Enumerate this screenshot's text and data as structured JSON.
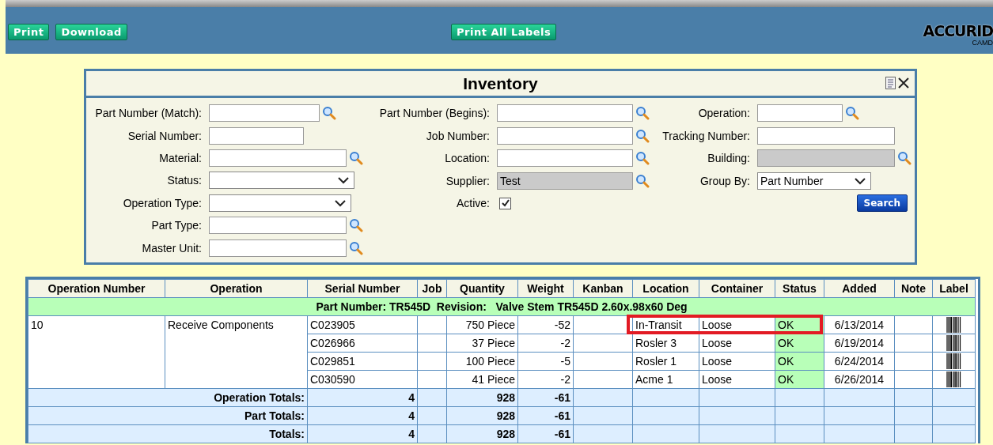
{
  "header": {
    "buttons": [
      "Print",
      "Download"
    ],
    "center_button": "Print All Labels",
    "logo": {
      "name": "ACCURID",
      "sub": "CAMD"
    }
  },
  "panel": {
    "title": "Inventory",
    "columns": [
      [
        {
          "label": "Part Number (Match):",
          "kind": "text",
          "lookup": true,
          "disabled": false
        },
        {
          "label": "Serial Number:",
          "kind": "text",
          "lookup": false,
          "disabled": false
        },
        {
          "label": "Material:",
          "kind": "text",
          "lookup": true,
          "disabled": false
        },
        {
          "label": "Status:",
          "kind": "select",
          "lookup": false,
          "disabled": false
        },
        {
          "label": "Operation Type:",
          "kind": "select",
          "lookup": false,
          "disabled": false
        },
        {
          "label": "Part Type:",
          "kind": "text",
          "lookup": true,
          "disabled": false
        },
        {
          "label": "Master Unit:",
          "kind": "text",
          "lookup": true,
          "disabled": false
        }
      ],
      [
        {
          "label": "Part Number (Begins):",
          "kind": "text",
          "lookup": true,
          "disabled": false
        },
        {
          "label": "Job Number:",
          "kind": "text",
          "lookup": true,
          "disabled": false
        },
        {
          "label": "Location:",
          "kind": "text",
          "lookup": true,
          "disabled": false
        },
        {
          "label": "Supplier:",
          "kind": "text",
          "value": "Test",
          "lookup": true,
          "disabled": true
        },
        {
          "label": "Active:",
          "kind": "checkbox",
          "checked": true
        }
      ],
      [
        {
          "label": "Operation:",
          "kind": "text",
          "lookup": true,
          "disabled": false
        },
        {
          "label": "Tracking Number:",
          "kind": "text",
          "lookup": false,
          "disabled": false
        },
        {
          "label": "Building:",
          "kind": "text",
          "lookup": true,
          "disabled": true
        },
        {
          "label": "Group By:",
          "kind": "select",
          "value": "Part Number",
          "lookup": false,
          "disabled": false
        }
      ]
    ],
    "search_button": "Search"
  },
  "table": {
    "columns": [
      "Operation Number",
      "Operation",
      "Serial Number",
      "Job",
      "Quantity",
      "Weight",
      "Kanban",
      "Location",
      "Container",
      "Status",
      "Added",
      "Note",
      "Label"
    ],
    "group": "Part Number: TR545D  Revision:   Valve Stem TR545D 2.60x.98x60 Deg",
    "operation_number": "10",
    "operation": "Receive Components",
    "rows": [
      {
        "serial": "C023905",
        "quantity": "750 Piece",
        "weight": "-52",
        "location": "In-Transit",
        "container": "Loose",
        "status": "OK",
        "added": "6/13/2014",
        "highlighted": true
      },
      {
        "serial": "C026966",
        "quantity": "37 Piece",
        "weight": "-2",
        "location": "Rosler 3",
        "container": "Loose",
        "status": "OK",
        "added": "6/19/2014",
        "highlighted": false
      },
      {
        "serial": "C029851",
        "quantity": "100 Piece",
        "weight": "-5",
        "location": "Rosler 1",
        "container": "Loose",
        "status": "OK",
        "added": "6/24/2014",
        "highlighted": false
      },
      {
        "serial": "C030590",
        "quantity": "41 Piece",
        "weight": "-2",
        "location": "Acme 1",
        "container": "Loose",
        "status": "OK",
        "added": "6/26/2014",
        "highlighted": false
      }
    ],
    "totals": [
      {
        "label": "Operation Totals:",
        "count": "4",
        "quantity": "928",
        "weight": "-61"
      },
      {
        "label": "Part Totals:",
        "count": "4",
        "quantity": "928",
        "weight": "-61"
      },
      {
        "label": "Totals:",
        "count": "4",
        "quantity": "928",
        "weight": "-61"
      }
    ]
  }
}
